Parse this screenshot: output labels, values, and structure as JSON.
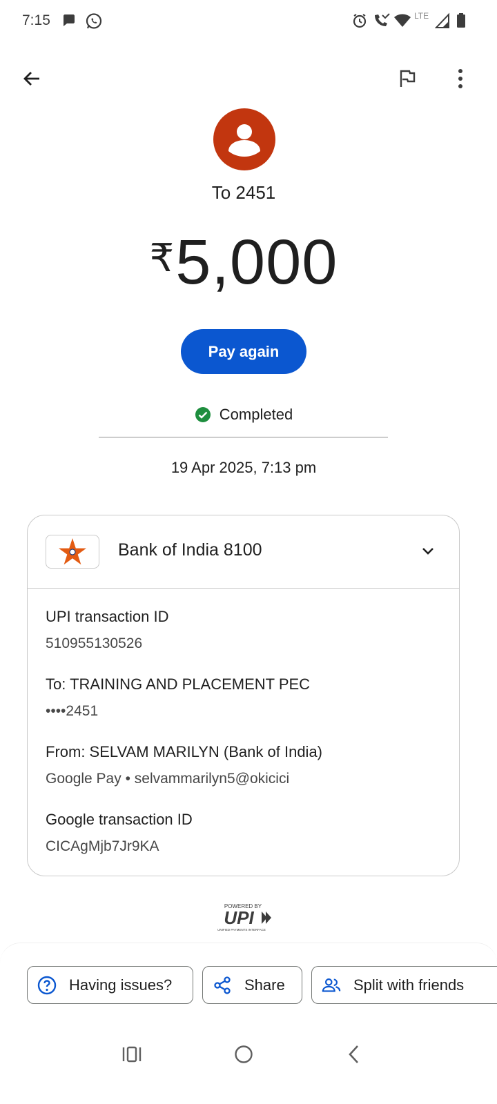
{
  "status_bar": {
    "time": "7:15",
    "network": "LTE",
    "left_icons": [
      "chat-bubble-icon",
      "whatsapp-icon"
    ],
    "right_icons": [
      "alarm-icon",
      "wifi-calling-icon",
      "wifi-icon",
      "signal-icon",
      "battery-icon"
    ]
  },
  "app_bar": {
    "icons": [
      "back-arrow-icon",
      "flag-icon",
      "more-vert-icon"
    ]
  },
  "header": {
    "recipient_title": "To 2451",
    "currency_symbol": "₹",
    "amount": "5,000",
    "pay_again_label": "Pay again",
    "status_text": "Completed",
    "date_time": "19 Apr 2025, 7:13 pm",
    "avatar_color": "#c2360f"
  },
  "card": {
    "bank_name": "Bank of India 8100",
    "details": [
      {
        "label": "UPI transaction ID",
        "value": "510955130526"
      },
      {
        "label": "To: TRAINING AND PLACEMENT PEC",
        "value": "••••2451"
      },
      {
        "label": "From: SELVAM MARILYN (Bank of India)",
        "value": "Google Pay • selvammarilyn5@okicici"
      },
      {
        "label": "Google transaction ID",
        "value": "CICAgMjb7Jr9KA"
      }
    ]
  },
  "footer_logo": {
    "powered_by": "POWERED BY",
    "brand": "UPI",
    "tagline": "UNIFIED PAYMENTS INTERFACE"
  },
  "actions": [
    {
      "label": "Having issues?",
      "icon": "help-icon"
    },
    {
      "label": "Share",
      "icon": "share-icon"
    },
    {
      "label": "Split with friends",
      "icon": "group-icon"
    }
  ],
  "colors": {
    "primary": "#0b57d0",
    "success": "#1e8e3e",
    "text": "#1f1f1f",
    "secondary_text": "#474747"
  }
}
